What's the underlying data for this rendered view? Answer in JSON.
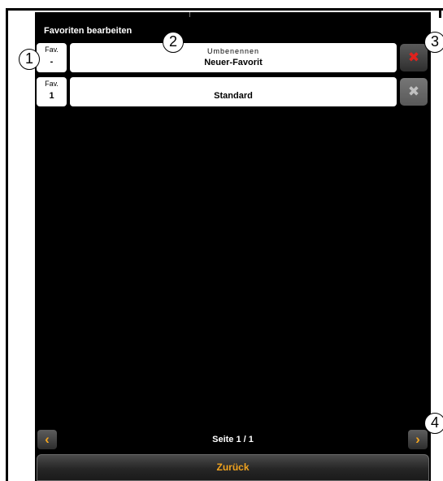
{
  "window": {
    "title": "Favoriten bearbeiten"
  },
  "favorites": [
    {
      "fav_label": "Fav.",
      "fav_number": "-",
      "rename_hint": "Umbenennen",
      "name": "Neuer-Favorit",
      "delete_icon": "close-icon",
      "delete_state": "active"
    },
    {
      "fav_label": "Fav.",
      "fav_number": "1",
      "name": "Standard",
      "delete_icon": "close-icon",
      "delete_state": "inactive"
    }
  ],
  "pager": {
    "prev_symbol": "‹",
    "next_symbol": "›",
    "text": "Seite 1 / 1"
  },
  "back_button": {
    "label": "Zurück"
  },
  "callouts": [
    "1",
    "2",
    "3",
    "4"
  ],
  "colors": {
    "screen_bg": "#000000",
    "accent_orange": "#f2a41f",
    "delete_red": "#e0221d",
    "delete_inactive": "#c0c0c0"
  }
}
